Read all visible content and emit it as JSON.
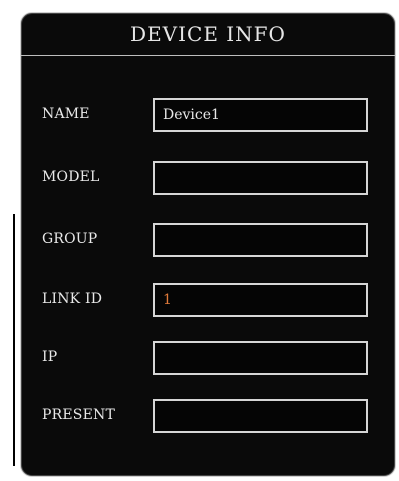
{
  "window": {
    "title": "DEVICE INFO"
  },
  "fields": [
    {
      "label": "NAME",
      "value": "Device1",
      "value_color": "#e8e8e8"
    },
    {
      "label": "MODEL",
      "value": "",
      "value_color": "#e8e8e8"
    },
    {
      "label": "GROUP",
      "value": "",
      "value_color": "#e8e8e8"
    },
    {
      "label": "LINK ID",
      "value": "1",
      "value_color": "#e07a3a"
    },
    {
      "label": "IP",
      "value": "",
      "value_color": "#e8e8e8"
    },
    {
      "label": "PRESENT",
      "value": "",
      "value_color": "#e8e8e8"
    }
  ],
  "colors": {
    "panel_background": "#0a0a0a",
    "border": "#d6d6d6",
    "text": "#e9e9e9",
    "accent_value": "#e07a3a"
  }
}
